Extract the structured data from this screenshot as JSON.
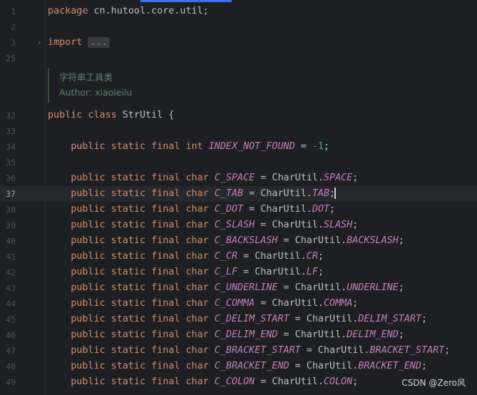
{
  "editor": {
    "lines": [
      {
        "num": "1",
        "tokens": [
          {
            "t": "package",
            "c": "kw"
          },
          {
            "t": " cn.hutool.core.util;",
            "c": ""
          }
        ]
      },
      {
        "num": "2",
        "tokens": []
      },
      {
        "num": "3",
        "fold": "›",
        "tokens": [
          {
            "t": "import",
            "c": "kw"
          },
          {
            "t": " ",
            "c": ""
          },
          {
            "t": "...",
            "c": "folded"
          }
        ]
      },
      {
        "num": "25",
        "tokens": []
      },
      {
        "num": "32",
        "tokens": [
          {
            "t": "public class",
            "c": "kw"
          },
          {
            "t": " StrUtil {",
            "c": ""
          }
        ]
      },
      {
        "num": "33",
        "tokens": []
      },
      {
        "num": "34",
        "tokens": [
          {
            "t": "    ",
            "c": ""
          },
          {
            "t": "public static final int",
            "c": "kw"
          },
          {
            "t": " ",
            "c": ""
          },
          {
            "t": "INDEX_NOT_FOUND",
            "c": "const"
          },
          {
            "t": " = ",
            "c": ""
          },
          {
            "t": "-1",
            "c": "num"
          },
          {
            "t": ";",
            "c": ""
          }
        ]
      },
      {
        "num": "35",
        "tokens": []
      },
      {
        "num": "36",
        "tokens": [
          {
            "t": "    ",
            "c": ""
          },
          {
            "t": "public static final char",
            "c": "kw"
          },
          {
            "t": " ",
            "c": ""
          },
          {
            "t": "C_SPACE",
            "c": "const"
          },
          {
            "t": " = CharUtil.",
            "c": ""
          },
          {
            "t": "SPACE",
            "c": "const"
          },
          {
            "t": ";",
            "c": ""
          }
        ]
      },
      {
        "num": "37",
        "current": true,
        "tokens": [
          {
            "t": "    ",
            "c": ""
          },
          {
            "t": "public static final char",
            "c": "kw"
          },
          {
            "t": " ",
            "c": ""
          },
          {
            "t": "C_TAB",
            "c": "const"
          },
          {
            "t": " = CharUtil.",
            "c": ""
          },
          {
            "t": "TAB",
            "c": "const"
          },
          {
            "t": ";",
            "c": ""
          }
        ]
      },
      {
        "num": "38",
        "tokens": [
          {
            "t": "    ",
            "c": ""
          },
          {
            "t": "public static final char",
            "c": "kw"
          },
          {
            "t": " ",
            "c": ""
          },
          {
            "t": "C_DOT",
            "c": "const"
          },
          {
            "t": " = CharUtil.",
            "c": ""
          },
          {
            "t": "DOT",
            "c": "const"
          },
          {
            "t": ";",
            "c": ""
          }
        ]
      },
      {
        "num": "39",
        "tokens": [
          {
            "t": "    ",
            "c": ""
          },
          {
            "t": "public static final char",
            "c": "kw"
          },
          {
            "t": " ",
            "c": ""
          },
          {
            "t": "C_SLASH",
            "c": "const"
          },
          {
            "t": " = CharUtil.",
            "c": ""
          },
          {
            "t": "SLASH",
            "c": "const"
          },
          {
            "t": ";",
            "c": ""
          }
        ]
      },
      {
        "num": "40",
        "tokens": [
          {
            "t": "    ",
            "c": ""
          },
          {
            "t": "public static final char",
            "c": "kw"
          },
          {
            "t": " ",
            "c": ""
          },
          {
            "t": "C_BACKSLASH",
            "c": "const"
          },
          {
            "t": " = CharUtil.",
            "c": ""
          },
          {
            "t": "BACKSLASH",
            "c": "const"
          },
          {
            "t": ";",
            "c": ""
          }
        ]
      },
      {
        "num": "41",
        "tokens": [
          {
            "t": "    ",
            "c": ""
          },
          {
            "t": "public static final char",
            "c": "kw"
          },
          {
            "t": " ",
            "c": ""
          },
          {
            "t": "C_CR",
            "c": "const"
          },
          {
            "t": " = CharUtil.",
            "c": ""
          },
          {
            "t": "CR",
            "c": "const"
          },
          {
            "t": ";",
            "c": ""
          }
        ]
      },
      {
        "num": "42",
        "tokens": [
          {
            "t": "    ",
            "c": ""
          },
          {
            "t": "public static final char",
            "c": "kw"
          },
          {
            "t": " ",
            "c": ""
          },
          {
            "t": "C_LF",
            "c": "const"
          },
          {
            "t": " = CharUtil.",
            "c": ""
          },
          {
            "t": "LF",
            "c": "const"
          },
          {
            "t": ";",
            "c": ""
          }
        ]
      },
      {
        "num": "43",
        "tokens": [
          {
            "t": "    ",
            "c": ""
          },
          {
            "t": "public static final char",
            "c": "kw"
          },
          {
            "t": " ",
            "c": ""
          },
          {
            "t": "C_UNDERLINE",
            "c": "const"
          },
          {
            "t": " = CharUtil.",
            "c": ""
          },
          {
            "t": "UNDERLINE",
            "c": "const"
          },
          {
            "t": ";",
            "c": ""
          }
        ]
      },
      {
        "num": "44",
        "tokens": [
          {
            "t": "    ",
            "c": ""
          },
          {
            "t": "public static final char",
            "c": "kw"
          },
          {
            "t": " ",
            "c": ""
          },
          {
            "t": "C_COMMA",
            "c": "const"
          },
          {
            "t": " = CharUtil.",
            "c": ""
          },
          {
            "t": "COMMA",
            "c": "const"
          },
          {
            "t": ";",
            "c": ""
          }
        ]
      },
      {
        "num": "45",
        "tokens": [
          {
            "t": "    ",
            "c": ""
          },
          {
            "t": "public static final char",
            "c": "kw"
          },
          {
            "t": " ",
            "c": ""
          },
          {
            "t": "C_DELIM_START",
            "c": "const"
          },
          {
            "t": " = CharUtil.",
            "c": ""
          },
          {
            "t": "DELIM_START",
            "c": "const"
          },
          {
            "t": ";",
            "c": ""
          }
        ]
      },
      {
        "num": "46",
        "tokens": [
          {
            "t": "    ",
            "c": ""
          },
          {
            "t": "public static final char",
            "c": "kw"
          },
          {
            "t": " ",
            "c": ""
          },
          {
            "t": "C_DELIM_END",
            "c": "const"
          },
          {
            "t": " = CharUtil.",
            "c": ""
          },
          {
            "t": "DELIM_END",
            "c": "const"
          },
          {
            "t": ";",
            "c": ""
          }
        ]
      },
      {
        "num": "47",
        "tokens": [
          {
            "t": "    ",
            "c": ""
          },
          {
            "t": "public static final char",
            "c": "kw"
          },
          {
            "t": " ",
            "c": ""
          },
          {
            "t": "C_BRACKET_START",
            "c": "const"
          },
          {
            "t": " = CharUtil.",
            "c": ""
          },
          {
            "t": "BRACKET_START",
            "c": "const"
          },
          {
            "t": ";",
            "c": ""
          }
        ]
      },
      {
        "num": "48",
        "tokens": [
          {
            "t": "    ",
            "c": ""
          },
          {
            "t": "public static final char",
            "c": "kw"
          },
          {
            "t": " ",
            "c": ""
          },
          {
            "t": "C_BRACKET_END",
            "c": "const"
          },
          {
            "t": " = CharUtil.",
            "c": ""
          },
          {
            "t": "BRACKET_END",
            "c": "const"
          },
          {
            "t": ";",
            "c": ""
          }
        ]
      },
      {
        "num": "49",
        "tokens": [
          {
            "t": "    ",
            "c": ""
          },
          {
            "t": "public static final char",
            "c": "kw"
          },
          {
            "t": " ",
            "c": ""
          },
          {
            "t": "C_COLON",
            "c": "const"
          },
          {
            "t": " = CharUtil.",
            "c": ""
          },
          {
            "t": "COLON",
            "c": "const"
          },
          {
            "t": ";",
            "c": ""
          }
        ]
      }
    ],
    "doc_comment": {
      "title": "字符串工具类",
      "author": "Author: xiaoleilu"
    },
    "colors": {
      "background": "#1e1f22",
      "keyword": "#cf8e6d",
      "constant": "#c77dbb",
      "number": "#2aacb8",
      "comment": "#5f826b",
      "text": "#bcbec4",
      "current_line": "#26282e"
    }
  },
  "watermark": "CSDN @Zero风"
}
